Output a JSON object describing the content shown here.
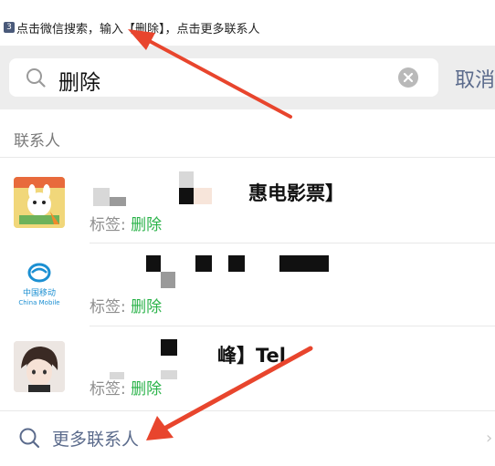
{
  "instruction": {
    "step": "3",
    "text": "点击微信搜索，输入【删除】，点击更多联系人"
  },
  "search": {
    "query": "删除",
    "cancel_label": "取消"
  },
  "section": {
    "label": "联系人"
  },
  "contacts": [
    {
      "name_fragment": "惠电影票】",
      "tag_prefix": "标签: ",
      "tag_highlight": "删除",
      "avatar": "cartoon-avatar"
    },
    {
      "name_fragment": "",
      "tag_prefix": "标签: ",
      "tag_highlight": "删除",
      "avatar": "china-mobile-logo",
      "avatar_text_cn": "中国移动",
      "avatar_text_en": "China Mobile"
    },
    {
      "name_fragment": "峰】Tel",
      "tag_prefix": "标签: ",
      "tag_highlight": "删除",
      "avatar": "anime-avatar"
    }
  ],
  "more": {
    "label": "更多联系人"
  },
  "colors": {
    "accent_red": "#e8452d",
    "highlight_green": "#2bb34a",
    "link_blue": "#5b6b8c"
  }
}
